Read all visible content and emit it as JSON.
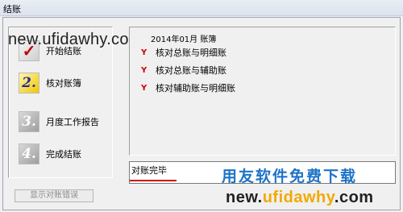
{
  "window": {
    "title": "结账"
  },
  "steps": [
    {
      "number": "",
      "label": "开始结账",
      "icon": "checkmark-icon"
    },
    {
      "number": "2.",
      "label": "核对账簿",
      "icon": "step-2-icon"
    },
    {
      "number": "3.",
      "label": "月度工作报告",
      "icon": "step-3-icon"
    },
    {
      "number": "4.",
      "label": "完成结账",
      "icon": "step-4-icon"
    }
  ],
  "check_list": {
    "header": "2014年01月 账簿",
    "mark": "Y",
    "items": [
      "核对总账与明细账",
      "核对总账与辅助账",
      "核对辅助账与明细账"
    ]
  },
  "status": {
    "text": "对账完毕"
  },
  "buttons": {
    "show_errors": "显示对账错误"
  },
  "watermarks": {
    "url_top": "new.ufidawhy.com",
    "slogan": "用友软件免费下载",
    "url_bottom_a": "new.",
    "url_bottom_b": "ufidawhy",
    "url_bottom_c": ".com"
  },
  "colors": {
    "mark_red": "#d00000",
    "watermark_blue": "#1e73c8",
    "watermark_orange": "#f2a900"
  }
}
